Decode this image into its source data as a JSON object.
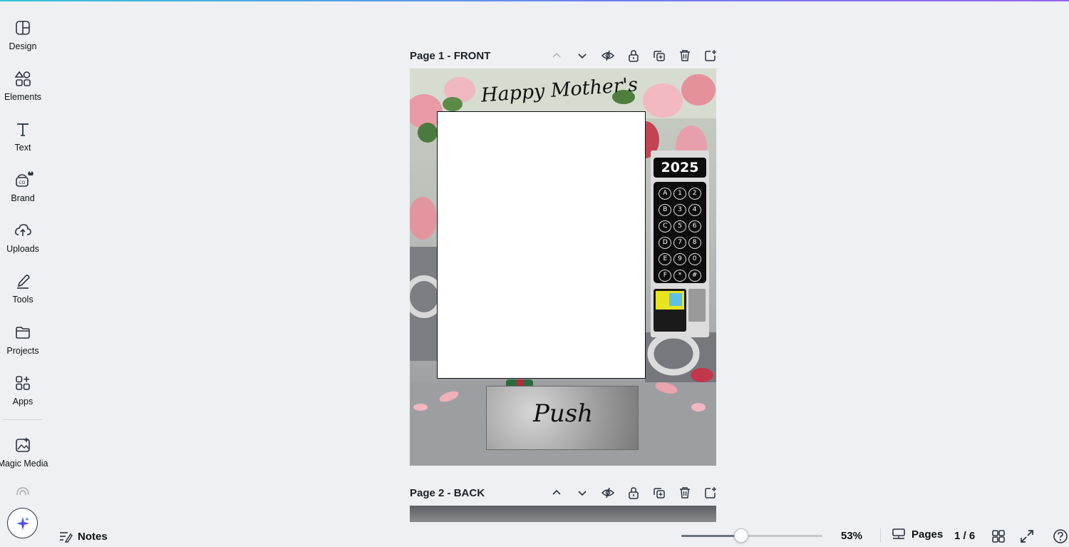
{
  "rail": {
    "items": [
      {
        "label": "Design",
        "icon": "design-icon"
      },
      {
        "label": "Elements",
        "icon": "elements-icon"
      },
      {
        "label": "Text",
        "icon": "text-icon"
      },
      {
        "label": "Brand",
        "icon": "brand-icon"
      },
      {
        "label": "Uploads",
        "icon": "uploads-icon"
      },
      {
        "label": "Tools",
        "icon": "tools-icon"
      },
      {
        "label": "Projects",
        "icon": "projects-icon"
      },
      {
        "label": "Apps",
        "icon": "apps-icon"
      },
      {
        "label": "Magic Media",
        "icon": "magic-media-icon"
      }
    ]
  },
  "pages": [
    {
      "title": "Page 1 - FRONT"
    },
    {
      "title": "Page 2 - BACK"
    }
  ],
  "design": {
    "heading": "Happy Mother's Day!",
    "push_label": "Push",
    "year": "2025",
    "keys": [
      "A",
      "1",
      "2",
      "B",
      "3",
      "4",
      "C",
      "5",
      "6",
      "D",
      "7",
      "8",
      "E",
      "9",
      "0",
      "F",
      "*",
      "#"
    ]
  },
  "bottom_bar": {
    "notes_label": "Notes",
    "zoom_value": "53%",
    "zoom_level_percent": 53,
    "pages_label": "Pages",
    "page_count": "1 / 6"
  },
  "colors": {
    "accent": "#7d2ae8",
    "background": "#eef0f3"
  }
}
